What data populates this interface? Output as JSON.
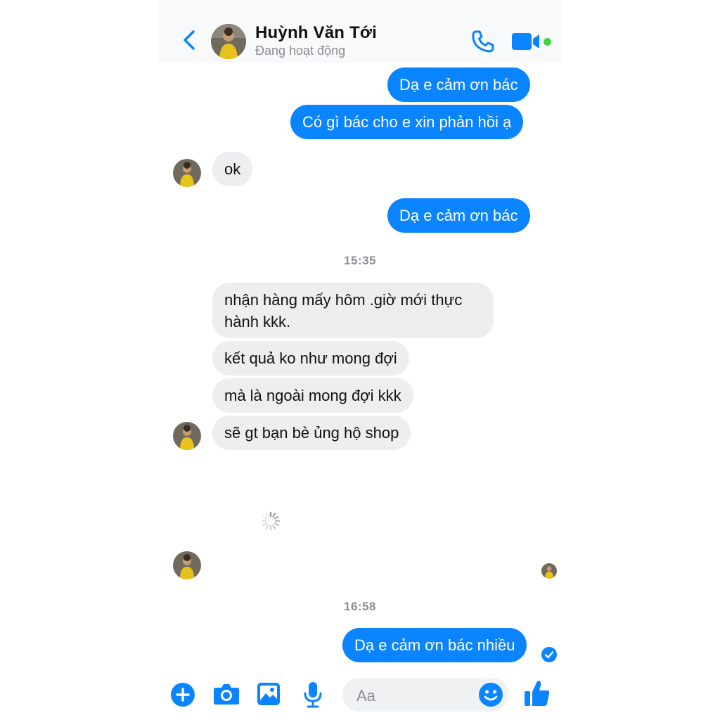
{
  "header": {
    "contact_name": "Huỳnh Văn Tới",
    "status": "Đang hoạt động",
    "icons": [
      "back-chevron-icon",
      "phone-icon",
      "video-camera-icon"
    ]
  },
  "messages": [
    {
      "dir": "out",
      "text": "Dạ e cảm ơn bác"
    },
    {
      "dir": "out",
      "text": "Có gì bác cho e xin phản hồi ạ"
    },
    {
      "dir": "in",
      "text": "ok"
    },
    {
      "dir": "out",
      "text": "Dạ e cảm ơn bác"
    },
    {
      "dir": "in",
      "text": "nhận hàng mấy hôm .giờ mới thực hành kkk."
    },
    {
      "dir": "in",
      "text": "kết quả ko như mong đợi"
    },
    {
      "dir": "in",
      "text": "mà là ngoài mong đợi kkk"
    },
    {
      "dir": "in",
      "text": "sẽ gt bạn bè ủng hộ shop"
    },
    {
      "dir": "out",
      "text": "Dạ e cảm ơn bác nhiều"
    }
  ],
  "timestamps": [
    "15:35",
    "16:58"
  ],
  "composer": {
    "placeholder": "Aa",
    "icons": [
      "plus-icon",
      "camera-icon",
      "photo-icon",
      "microphone-icon",
      "emoji-icon",
      "thumbs-up-icon"
    ]
  },
  "colors": {
    "accent": "#0a84ff",
    "incoming_bubble": "#eeeef0",
    "online": "#42d742"
  }
}
